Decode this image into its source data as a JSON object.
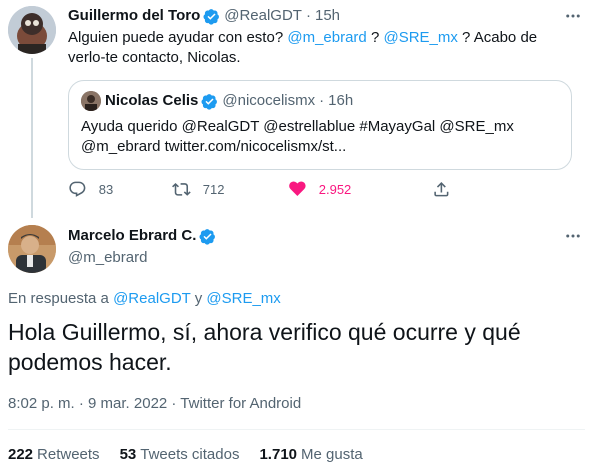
{
  "tweet1": {
    "name": "Guillermo del Toro",
    "handle": "@RealGDT",
    "time": "15h",
    "text_pre": "Alguien puede ayudar con esto? ",
    "mention1": "@m_ebrard",
    "text_mid": " ? ",
    "mention2": "@SRE_mx",
    "text_post": " ? Acabo de verlo-te contacto, Nicolas."
  },
  "quote": {
    "name": "Nicolas Celis",
    "handle": "@nicocelismx",
    "time": "16h",
    "text_line1": "Ayuda querido @RealGDT @estrellablue #MayayGal @SRE_mx",
    "text_line2": "@m_ebrard twitter.com/nicocelismx/st..."
  },
  "actions": {
    "replies": "83",
    "retweets": "712",
    "likes": "2.952"
  },
  "tweet2": {
    "name": "Marcelo Ebrard C.",
    "handle": "@m_ebrard",
    "reply_prefix": "En respuesta a ",
    "reply_to1": "@RealGDT",
    "reply_and": " y ",
    "reply_to2": "@SRE_mx",
    "text": "Hola Guillermo, sí, ahora verifico qué ocurre y qué podemos hacer.",
    "timestamp": "8:02 p. m. · 9 mar. 2022 · Twitter for Android"
  },
  "stats": {
    "retweets_count": "222",
    "retweets_label": "Retweets",
    "quotes_count": "53",
    "quotes_label": "Tweets citados",
    "likes_count": "1.710",
    "likes_label": "Me gusta"
  },
  "colors": {
    "link": "#1d9bf0",
    "like": "#f91880",
    "muted": "#536471",
    "text": "#0f1419"
  },
  "icons": {
    "verified": "verified-badge-icon",
    "reply": "reply-icon",
    "retweet": "retweet-icon",
    "like": "heart-icon",
    "share": "share-icon",
    "more": "more-icon"
  }
}
